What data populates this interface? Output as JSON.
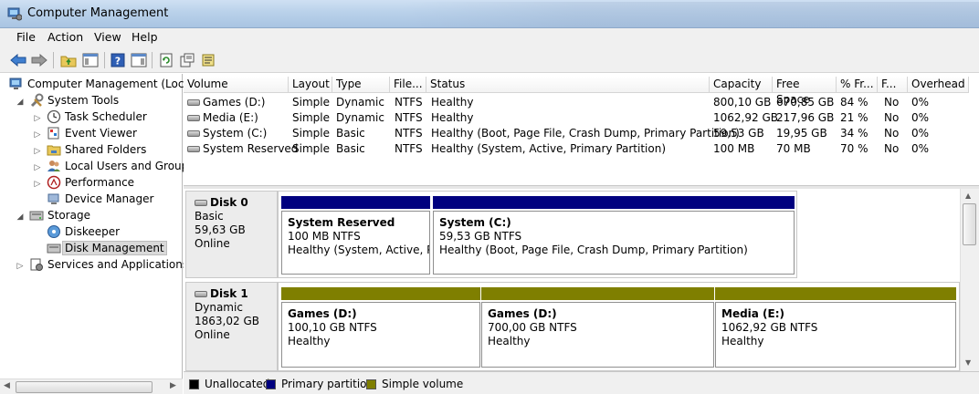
{
  "window": {
    "title": "Computer Management"
  },
  "menu": [
    "File",
    "Action",
    "View",
    "Help"
  ],
  "toolbar_icons": [
    "back-arrow-icon",
    "forward-arrow-icon",
    "up-folder-icon",
    "show-hide-tree-icon",
    "help-icon",
    "action-pane-icon",
    "refresh-icon",
    "properties-icon",
    "export-list-icon"
  ],
  "tree": {
    "root": "Computer Management (Local",
    "system_tools": "System Tools",
    "task_scheduler": "Task Scheduler",
    "event_viewer": "Event Viewer",
    "shared_folders": "Shared Folders",
    "local_users": "Local Users and Groups",
    "performance": "Performance",
    "device_manager": "Device Manager",
    "storage": "Storage",
    "diskeeper": "Diskeeper",
    "disk_management": "Disk Management",
    "services": "Services and Applications"
  },
  "volume_table": {
    "columns": [
      "Volume",
      "Layout",
      "Type",
      "File...",
      "Status",
      "Capacity",
      "Free Space",
      "% Fr...",
      "F...",
      "Overhead"
    ],
    "rows": [
      [
        "Games (D:)",
        "Simple",
        "Dynamic",
        "NTFS",
        "Healthy",
        "800,10 GB",
        "670,85 GB",
        "84 %",
        "No",
        "0%"
      ],
      [
        "Media (E:)",
        "Simple",
        "Dynamic",
        "NTFS",
        "Healthy",
        "1062,92 GB",
        "217,96 GB",
        "21 %",
        "No",
        "0%"
      ],
      [
        "System (C:)",
        "Simple",
        "Basic",
        "NTFS",
        "Healthy (Boot, Page File, Crash Dump, Primary Partition)",
        "59,53 GB",
        "19,95 GB",
        "34 %",
        "No",
        "0%"
      ],
      [
        "System Reserved",
        "Simple",
        "Basic",
        "NTFS",
        "Healthy (System, Active, Primary Partition)",
        "100 MB",
        "70 MB",
        "70 %",
        "No",
        "0%"
      ]
    ]
  },
  "disks": [
    {
      "name": "Disk 0",
      "type": "Basic",
      "size": "59,63 GB",
      "state": "Online",
      "partitions": [
        {
          "name": "System Reserved",
          "size": "100 MB NTFS",
          "status": "Healthy (System, Active, Prir",
          "color": "#00007f"
        },
        {
          "name": "System  (C:)",
          "size": "59,53 GB NTFS",
          "status": "Healthy (Boot, Page File, Crash Dump, Primary Partition)",
          "color": "#00007f"
        }
      ]
    },
    {
      "name": "Disk 1",
      "type": "Dynamic",
      "size": "1863,02 GB",
      "state": "Online",
      "partitions": [
        {
          "name": "Games  (D:)",
          "size": "100,10 GB NTFS",
          "status": "Healthy",
          "color": "#7f7f00"
        },
        {
          "name": "Games  (D:)",
          "size": "700,00 GB NTFS",
          "status": "Healthy",
          "color": "#7f7f00"
        },
        {
          "name": "Media  (E:)",
          "size": "1062,92 GB NTFS",
          "status": "Healthy",
          "color": "#7f7f00"
        }
      ]
    }
  ],
  "legend": [
    {
      "label": "Unallocated",
      "color": "#000000"
    },
    {
      "label": "Primary partition",
      "color": "#00007f"
    },
    {
      "label": "Simple volume",
      "color": "#7f7f00"
    }
  ]
}
